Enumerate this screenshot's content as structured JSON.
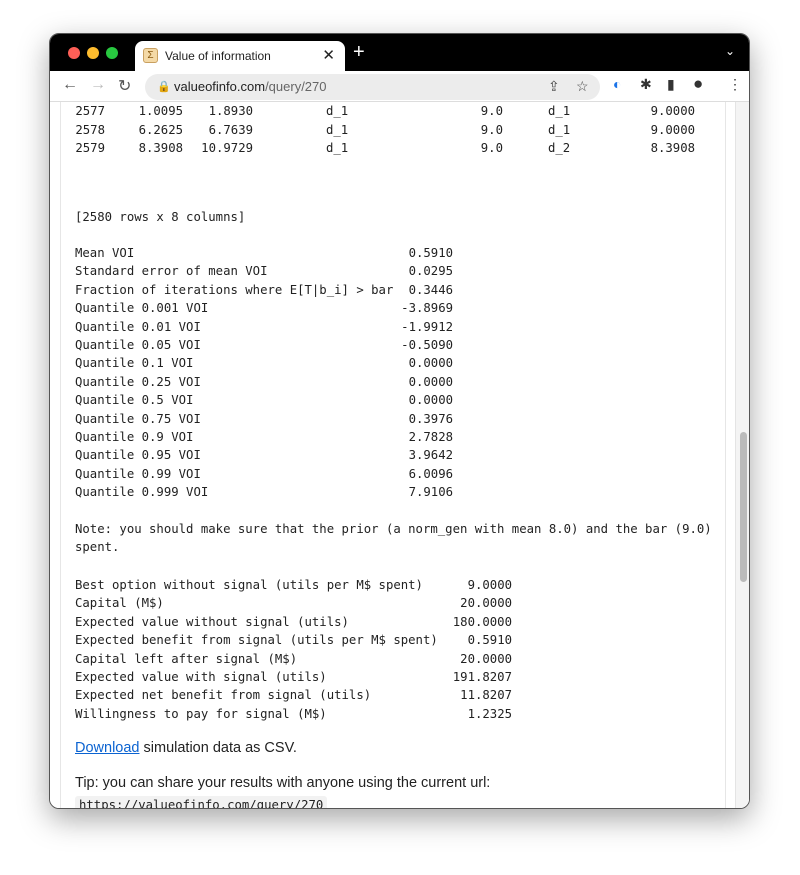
{
  "browser": {
    "tab_title": "Value of information",
    "url_host": "valueofinfo.com",
    "url_path": "/query/270"
  },
  "table_rows": [
    [
      "2577",
      "1.0095",
      "1.8930",
      "d_1",
      "9.0",
      "d_1",
      "9.0000"
    ],
    [
      "2578",
      "6.2625",
      "6.7639",
      "d_1",
      "9.0",
      "d_1",
      "9.0000"
    ],
    [
      "2579",
      "8.3908",
      "10.9729",
      "d_1",
      "9.0",
      "d_2",
      "8.3908"
    ]
  ],
  "table_shape": "[2580 rows x 8 columns]",
  "voi_stats": [
    [
      "Mean VOI",
      "0.5910"
    ],
    [
      "Standard error of mean VOI",
      "0.0295"
    ],
    [
      "Fraction of iterations where E[T|b_i] > bar",
      "0.3446"
    ],
    [
      "Quantile 0.001 VOI",
      "-3.8969"
    ],
    [
      "Quantile 0.01 VOI",
      "-1.9912"
    ],
    [
      "Quantile 0.05 VOI",
      "-0.5090"
    ],
    [
      "Quantile 0.1 VOI",
      "0.0000"
    ],
    [
      "Quantile 0.25 VOI",
      "0.0000"
    ],
    [
      "Quantile 0.5 VOI",
      "0.0000"
    ],
    [
      "Quantile 0.75 VOI",
      "0.3976"
    ],
    [
      "Quantile 0.9 VOI",
      "2.7828"
    ],
    [
      "Quantile 0.95 VOI",
      "3.9642"
    ],
    [
      "Quantile 0.99 VOI",
      "6.0096"
    ],
    [
      "Quantile 0.999 VOI",
      "7.9106"
    ]
  ],
  "note_line1": "Note: you should make sure that the prior (a norm_gen with mean 8.0) and the bar (9.0)",
  "note_line2": "spent.",
  "summary": [
    [
      "Best option without signal (utils per M$ spent)",
      "9.0000"
    ],
    [
      "Capital (M$)",
      "20.0000"
    ],
    [
      "Expected value without signal (utils)",
      "180.0000"
    ],
    [
      "Expected benefit from signal (utils per M$ spent)",
      "0.5910"
    ],
    [
      "Capital left after signal (M$)",
      "20.0000"
    ],
    [
      "Expected value with signal (utils)",
      "191.8207"
    ],
    [
      "Expected net benefit from signal (utils)",
      "11.8207"
    ],
    [
      "Willingness to pay for signal (M$)",
      "1.2325"
    ]
  ],
  "download_link": "Download",
  "download_text": " simulation data as CSV.",
  "tip_text": "Tip: you can share your results with anyone using the current url:",
  "share_url": "https://valueofinfo.com/query/270"
}
